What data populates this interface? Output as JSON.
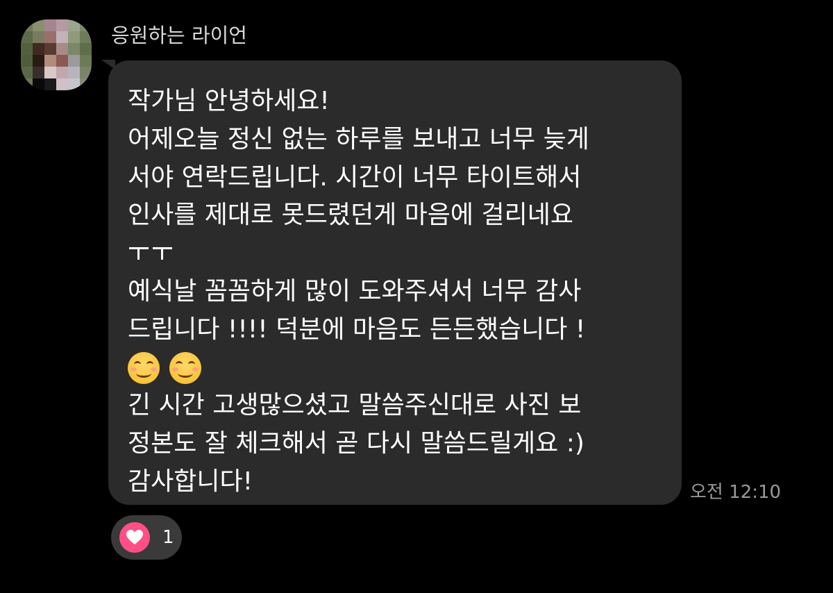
{
  "sender": {
    "name": "응원하는 라이언"
  },
  "message": {
    "lines": [
      "작가님 안녕하세요!",
      "어제오늘 정신 없는 하루를 보내고 너무 늦게",
      "서야 연락드립니다. 시간이 너무 타이트해서",
      "인사를 제대로 못드렸던게 마음에 걸리네요"
    ],
    "crying_emoticon": "ㅜㅜ",
    "lines_2": [
      "예식날 꼼꼼하게 많이 도와주셔서 너무 감사",
      "드립니다 !!!! 덕분에 마음도 든든했습니다 !"
    ],
    "emojis": [
      "smiling-face-icon",
      "smiling-face-icon"
    ],
    "lines_3": [
      "긴 시간 고생많으셨고 말씀주신대로 사진 보",
      "정본도 잘 체크해서 곧 다시 말씀드릴게요 :)",
      "감사합니다!"
    ]
  },
  "timestamp": "오전 12:10",
  "reaction": {
    "icon": "heart-icon",
    "count": "1"
  },
  "colors": {
    "background": "#000000",
    "bubble": "#2b2b2b",
    "reaction_pill": "#3a3a3a",
    "heart_badge": "#ff4f86",
    "timestamp": "#9a9a9a"
  }
}
